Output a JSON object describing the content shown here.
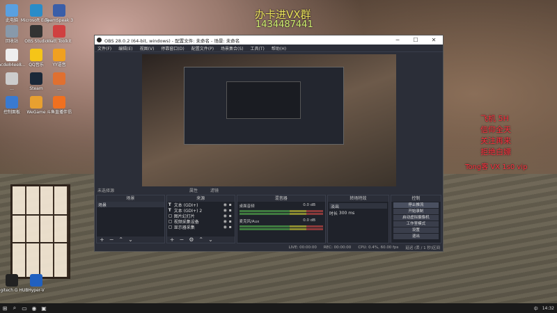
{
  "desktop_icons": [
    {
      "label": "此电脑",
      "color": "#5aa0e0"
    },
    {
      "label": "Microsoft Edge",
      "color": "#2a8cc8"
    },
    {
      "label": "TeamSpeak 3",
      "color": "#3b5ea8"
    },
    {
      "label": "回收站",
      "color": "#8899aa"
    },
    {
      "label": "OBS Studio",
      "color": "#333333"
    },
    {
      "label": "Watt Toolkit",
      "color": "#d04040"
    },
    {
      "label": "acde84ee8...",
      "color": "#eeeeee"
    },
    {
      "label": "QQ音乐",
      "color": "#f5c518"
    },
    {
      "label": "YY语音",
      "color": "#f0a020"
    },
    {
      "label": "...",
      "color": "#cccccc"
    },
    {
      "label": "Steam",
      "color": "#1b2838"
    },
    {
      "label": "...",
      "color": "#e07030"
    },
    {
      "label": "控制面板",
      "color": "#3a7ad0"
    },
    {
      "label": "WeGame",
      "color": "#e8a030"
    },
    {
      "label": "斗鱼直播伴侣",
      "color": "#f07020"
    },
    {
      "label": "Logitech G HUB",
      "color": "#222222"
    },
    {
      "label": "Hyper-V",
      "color": "#2060c0"
    }
  ],
  "overlays": {
    "top_text": "办卡进VX群",
    "top_number": "1434487441",
    "right_lines": [
      "飞机 5H",
      "信仰全天",
      "关注再来",
      "拒绝白嫖"
    ],
    "right_vx": "Tong客 VX 1s0 vip"
  },
  "obs": {
    "title": "OBS 28.0.2 (64-bit, windows) - 配置文件: 未命名 - 场景: 未命名",
    "menu": [
      "文件(F)",
      "编辑(E)",
      "视图(V)",
      "停靠窗口(D)",
      "配置文件(P)",
      "场景集合(S)",
      "工具(T)",
      "帮助(H)"
    ],
    "status_label": "未选择源",
    "status_actions": [
      "属性",
      "滤镜"
    ],
    "docks": {
      "scenes": {
        "header": "场景",
        "items": [
          "场景"
        ]
      },
      "sources": {
        "header": "来源",
        "items": [
          {
            "icon": "T",
            "name": "文本 (GDI+)"
          },
          {
            "icon": "T",
            "name": "文本 (GDI+) 2"
          },
          {
            "icon": "▢",
            "name": "图片幻灯片"
          },
          {
            "icon": "▢",
            "name": "视频采集设备"
          },
          {
            "icon": "▢",
            "name": "显示器采集"
          }
        ]
      },
      "mixer": {
        "header": "混音器",
        "channels": [
          {
            "name": "桌面音频",
            "db": "0.0 dB"
          },
          {
            "name": "麦克风/Aux",
            "db": "0.0 dB"
          }
        ]
      },
      "transitions": {
        "header": "转场特效",
        "mode": "淡出",
        "duration_label": "时长",
        "duration": "300 ms"
      },
      "controls": {
        "header": "控制",
        "buttons": [
          "停止推流",
          "开始录制",
          "启动虚拟摄像机",
          "工作室模式",
          "设置",
          "退出"
        ]
      }
    },
    "bottom_status": [
      "LIVE: 00:00:00",
      "REC: 00:00:00",
      "CPU: 0.4%, 60.00 fps",
      "延迟 (丢 / 1 秒)区间"
    ]
  },
  "taskbar": {
    "time": "14:32",
    "ime": "中",
    "items": [
      "⊞",
      "⌕",
      "▭",
      "◉",
      "▣"
    ]
  }
}
